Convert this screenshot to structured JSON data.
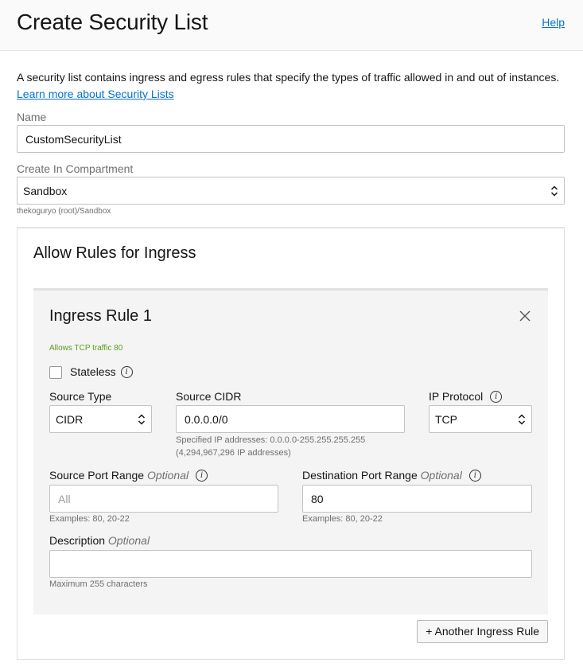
{
  "header": {
    "title": "Create Security List",
    "help_label": "Help"
  },
  "intro": {
    "text": "A security list contains ingress and egress rules that specify the types of traffic allowed in and out of instances.",
    "link_label": "Learn more about Security Lists"
  },
  "name_field": {
    "label": "Name",
    "value": "CustomSecurityList"
  },
  "compartment_field": {
    "label": "Create In Compartment",
    "value": "Sandbox",
    "path_hint": "thekoguryo (root)/Sandbox"
  },
  "ingress": {
    "section_title": "Allow Rules for Ingress",
    "add_rule_label": "+ Another Ingress Rule",
    "rule": {
      "title": "Ingress Rule 1",
      "summary": "Allows TCP traffic 80",
      "stateless": {
        "label": "Stateless",
        "checked": false
      },
      "source_type": {
        "label": "Source Type",
        "value": "CIDR"
      },
      "source_cidr": {
        "label": "Source CIDR",
        "value": "0.0.0.0/0",
        "hint_line1": "Specified IP addresses: 0.0.0.0-255.255.255.255",
        "hint_line2": "(4,294,967,296 IP addresses)"
      },
      "ip_protocol": {
        "label": "IP Protocol",
        "value": "TCP"
      },
      "source_port_range": {
        "label": "Source Port Range",
        "optional_label": "Optional",
        "placeholder": "All",
        "value": "",
        "hint": "Examples: 80, 20-22"
      },
      "destination_port_range": {
        "label": "Destination Port Range",
        "optional_label": "Optional",
        "value": "80",
        "hint": "Examples: 80, 20-22"
      },
      "description": {
        "label": "Description",
        "optional_label": "Optional",
        "value": "",
        "hint": "Maximum 255 characters"
      }
    }
  },
  "icons": {
    "info": "info-icon",
    "close": "close-icon",
    "select": "chevron-up-down-icon"
  },
  "colors": {
    "link": "#0572ce",
    "summary_green": "#5d9b1e",
    "panel_bg": "#f4f4f4"
  }
}
